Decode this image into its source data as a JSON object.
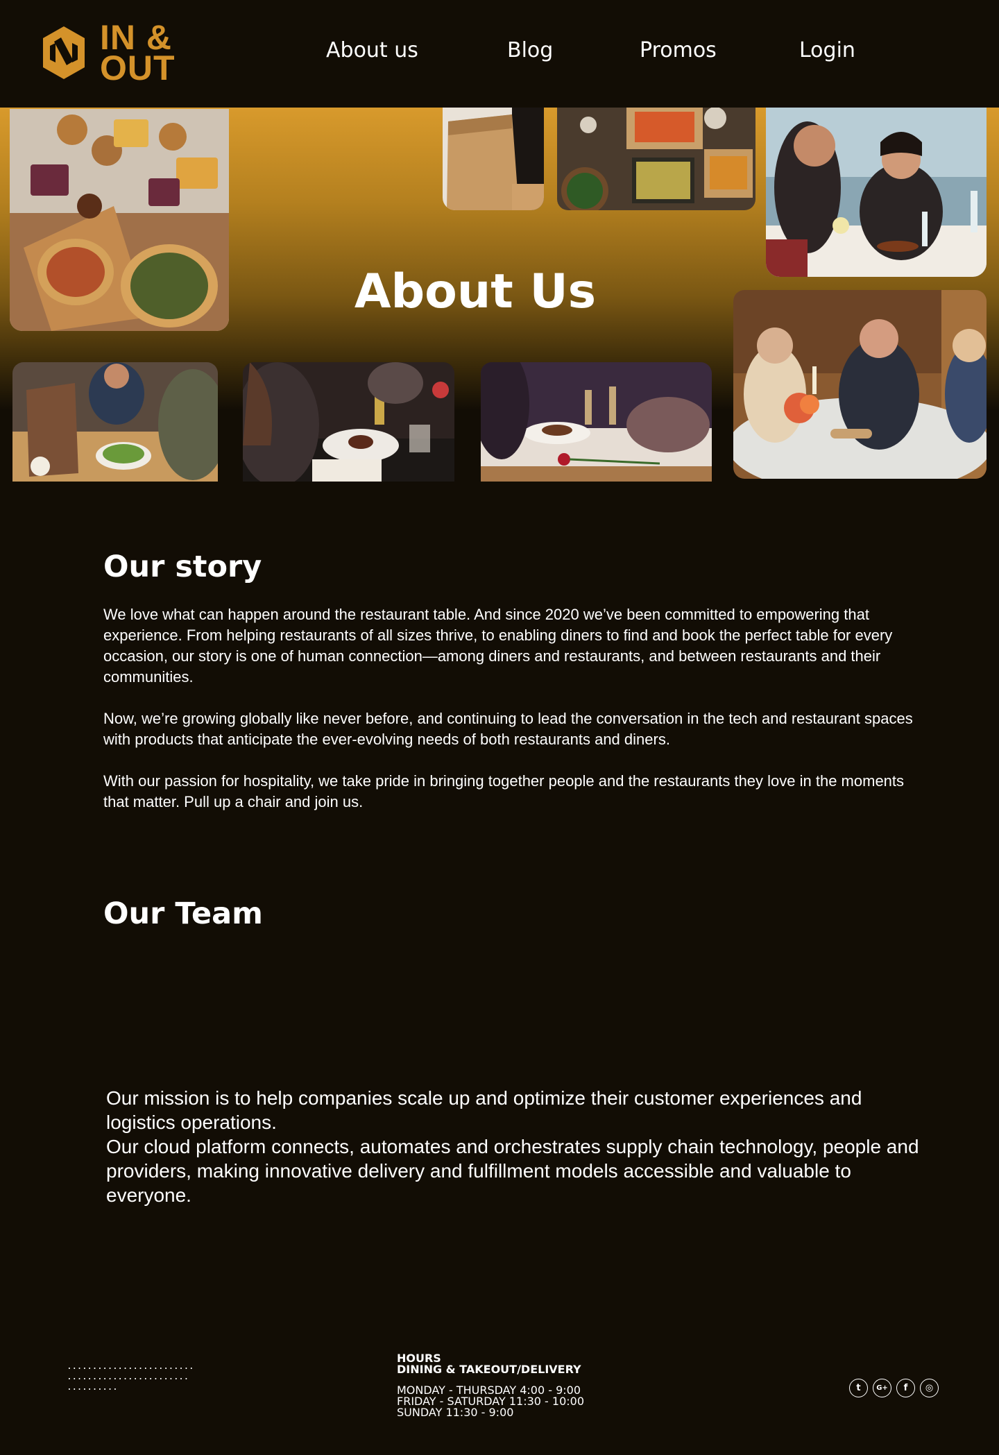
{
  "brand": {
    "name_line1": "IN &",
    "name_line2": "OUT",
    "color": "#d4922a"
  },
  "nav": {
    "items": [
      {
        "label": "About us"
      },
      {
        "label": "Blog"
      },
      {
        "label": "Promos"
      },
      {
        "label": "Login"
      }
    ]
  },
  "hero": {
    "title": "About Us",
    "gradient_top": "#d89a2c",
    "photos": [
      {
        "subject": "pizza-burgers-fries-table"
      },
      {
        "subject": "takeout-paper-bag"
      },
      {
        "subject": "takeout-boxes-salad"
      },
      {
        "subject": "couple-dining"
      },
      {
        "subject": "group-dinner-round-table"
      },
      {
        "subject": "friends-takeout-meal"
      },
      {
        "subject": "dessert-dinner-wine"
      },
      {
        "subject": "romantic-dinner-rose"
      }
    ]
  },
  "story": {
    "title": "Our story",
    "paragraphs": [
      "We love what can happen around the restaurant table. And since 2020 we’ve been committed to empowering that experience. From helping restaurants of all sizes thrive, to enabling diners to find and book the perfect table for every occasion, our story is one of human connection—among diners and restaurants, and between restaurants and their communities.",
      "Now, we’re growing globally like never before, and continuing to lead the conversation in the tech and restaurant spaces with products that anticipate the ever-evolving needs of both restaurants and diners.",
      "With our passion for hospitality, we take pride in bringing together people and the restaurants they love in the moments that matter. Pull up a chair and join us."
    ]
  },
  "team": {
    "title": "Our Team"
  },
  "mission": {
    "line1": "Our mission is to help companies scale up and optimize their customer experiences and logistics operations.",
    "line2": "Our cloud platform connects, automates and orchestrates supply chain technology, people and providers, making innovative delivery and fulfillment models accessible and valuable to everyone."
  },
  "footer": {
    "dots": [
      ".........................",
      "........................",
      ".........."
    ],
    "hours_heading": "HOURS",
    "hours_subheading": "DINING & TAKEOUT/DELIVERY",
    "hours_lines": [
      "MONDAY - THURSDAY 4:00 - 9:00",
      "FRIDAY - SATURDAY 11:30 - 10:00",
      "SUNDAY 11:30 - 9:00"
    ],
    "social": [
      {
        "icon": "twitter-icon",
        "glyph": "t"
      },
      {
        "icon": "google-plus-icon",
        "glyph": "G+"
      },
      {
        "icon": "facebook-icon",
        "glyph": "f"
      },
      {
        "icon": "instagram-icon",
        "glyph": "◎"
      }
    ]
  }
}
